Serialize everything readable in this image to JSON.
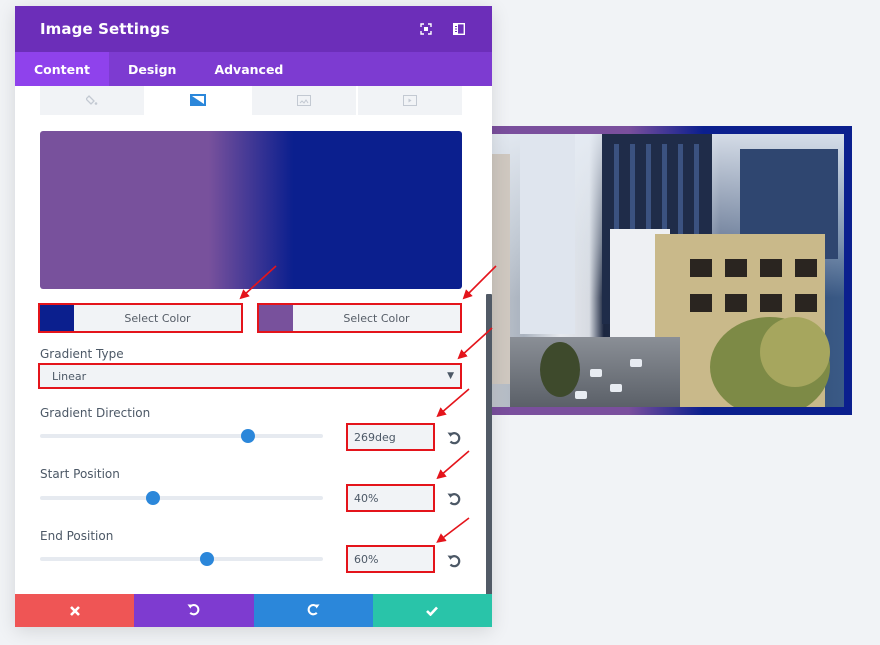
{
  "modal": {
    "title": "Image Settings",
    "header_icons": [
      "expand-icon",
      "sidebar-toggle-icon"
    ],
    "tabs": [
      {
        "label": "Content",
        "active": true
      },
      {
        "label": "Design",
        "active": false
      },
      {
        "label": "Advanced",
        "active": false
      }
    ],
    "background_tabs": [
      {
        "icon": "paint-bucket-icon",
        "active": false
      },
      {
        "icon": "gradient-icon",
        "active": true
      },
      {
        "icon": "image-icon",
        "active": false
      },
      {
        "icon": "video-icon",
        "active": false
      }
    ],
    "gradient": {
      "start_color": "#0b1f8e",
      "end_color": "#78519c"
    },
    "color_pickers": [
      {
        "label": "Select Color",
        "swatch": "#0b1f8e"
      },
      {
        "label": "Select Color",
        "swatch": "#78519c"
      }
    ],
    "gradient_type": {
      "label": "Gradient Type",
      "value": "Linear"
    },
    "gradient_direction": {
      "label": "Gradient Direction",
      "value": "269deg",
      "slider_fraction": 0.735
    },
    "start_position": {
      "label": "Start Position",
      "value": "40%",
      "slider_fraction": 0.4
    },
    "end_position": {
      "label": "End Position",
      "value": "60%",
      "slider_fraction": 0.59
    },
    "footer": {
      "cancel_icon": "close-icon",
      "undo_icon": "undo-icon",
      "redo_icon": "redo-icon",
      "save_icon": "check-icon"
    }
  },
  "colors": {
    "header": "#6c2eb9",
    "tabs_bar": "#7d3bd1",
    "active_tab": "#8f42ec",
    "slider_thumb": "#2b87da",
    "highlight": "#e4141b",
    "cancel": "#ef5555",
    "undo": "#7e3bd0",
    "redo": "#2b87da",
    "save": "#29c4a9"
  }
}
